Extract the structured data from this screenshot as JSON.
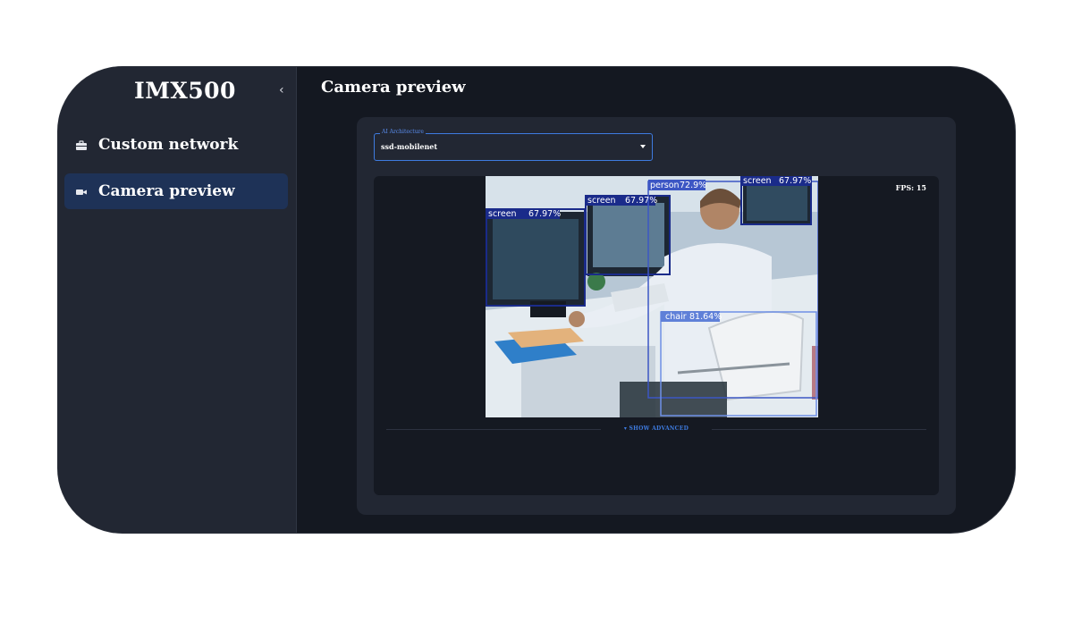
{
  "app": {
    "title": "IMX500",
    "collapse_icon": "chevron-left-icon"
  },
  "sidebar": {
    "items": [
      {
        "label": "Custom network",
        "icon": "briefcase-icon",
        "active": false
      },
      {
        "label": "Camera preview",
        "icon": "video-camera-icon",
        "active": true
      }
    ]
  },
  "main": {
    "title": "Camera preview",
    "ai_architecture": {
      "legend": "AI Architecture",
      "value": "ssd-mobilenet"
    },
    "preview": {
      "fps_label": "FPS: 15",
      "detections": [
        {
          "label": "screen",
          "score": "67.97%"
        },
        {
          "label": "screen",
          "score": "67.97%"
        },
        {
          "label": "person",
          "score": "72.9%"
        },
        {
          "label": "screen",
          "score": "67.97%"
        },
        {
          "label": "chair",
          "score": "81.64%"
        }
      ]
    },
    "show_advanced": "SHOW ADVANCED"
  },
  "colors": {
    "accent": "#3e7be0",
    "active_nav": "#1e3257",
    "panel": "#222733",
    "background": "#141821"
  }
}
